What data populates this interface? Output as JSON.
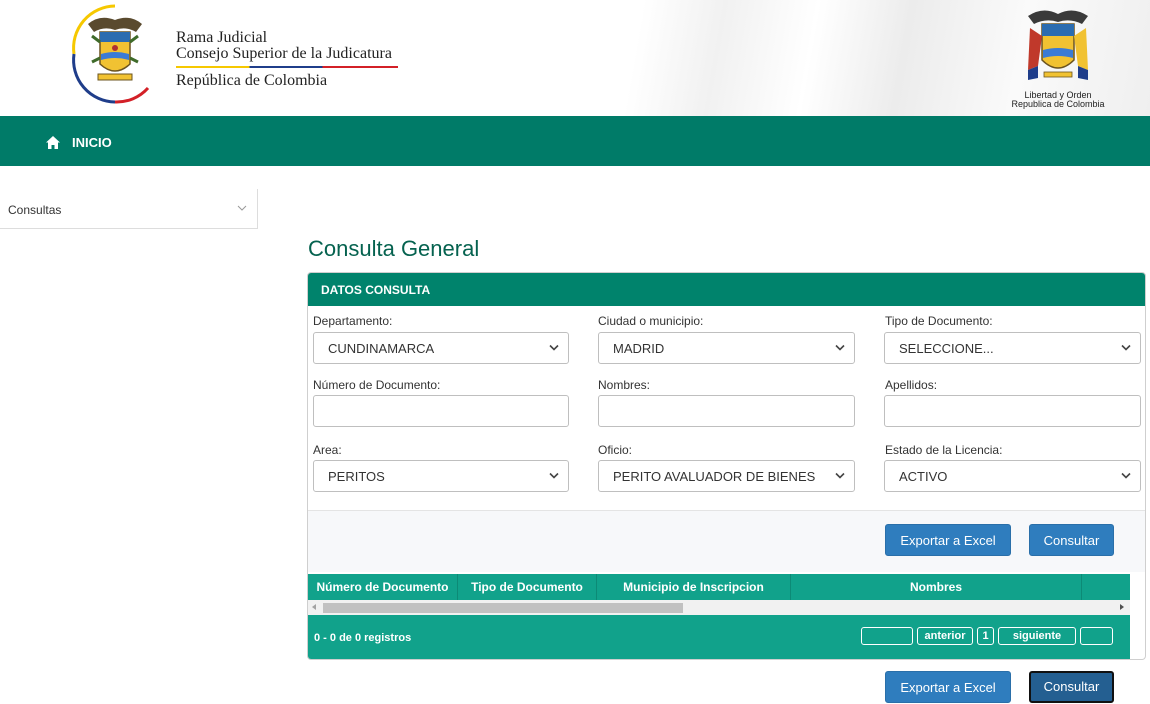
{
  "header": {
    "org_line1": "Rama Judicial",
    "org_line2": "Consejo Superior de la Judicatura",
    "org_line3": "República de Colombia",
    "coat_line1": "Libertad y Orden",
    "coat_line2": "Republica de Colombia"
  },
  "nav": {
    "home_label": "INICIO",
    "icon": "home-icon"
  },
  "sidebar": {
    "label": "Consultas",
    "icon": "chevron-down-icon"
  },
  "page": {
    "title": "Consulta General"
  },
  "panel": {
    "title": "DATOS CONSULTA",
    "fields": {
      "departamento": {
        "label": "Departamento:",
        "value": "CUNDINAMARCA"
      },
      "ciudad": {
        "label": "Ciudad o municipio:",
        "value": "MADRID"
      },
      "tipo_doc": {
        "label": "Tipo de Documento:",
        "value": "SELECCIONE..."
      },
      "numero_doc": {
        "label": "Número de Documento:",
        "value": ""
      },
      "nombres": {
        "label": "Nombres:",
        "value": ""
      },
      "apellidos": {
        "label": "Apellidos:",
        "value": ""
      },
      "area": {
        "label": "Area:",
        "value": "PERITOS"
      },
      "oficio": {
        "label": "Oficio:",
        "value": "PERITO AVALUADOR DE BIENES"
      },
      "estado": {
        "label": "Estado de la Licencia:",
        "value": "ACTIVO"
      }
    },
    "buttons": {
      "export": "Exportar a Excel",
      "consult": "Consultar"
    },
    "grid": {
      "columns": [
        "Número de Documento",
        "Tipo de Documento",
        "Municipio de Inscripcion",
        "Nombres"
      ],
      "records_text": "0 - 0 de 0 registros",
      "pager": {
        "prev": "anterior",
        "page": "1",
        "next": "siguiente"
      }
    }
  },
  "colors": {
    "primary_green": "#007b68",
    "header_green": "#00836c",
    "grid_teal": "#11a28b",
    "button_blue": "#2f7dbe",
    "title_green": "#05624f"
  }
}
